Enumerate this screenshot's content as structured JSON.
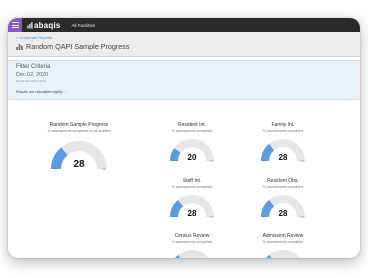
{
  "app": {
    "logo_text": "abaqis",
    "facility": "All Facilities"
  },
  "header": {
    "breadcrumb": "< Corporate Reports",
    "title": "Random QAPI Sample Progress"
  },
  "filter": {
    "title": "Filter Criteria",
    "date": "Dec 02, 2020",
    "date_label": "REFERENCE DATE",
    "note": "Results are calculated nightly ..."
  },
  "colors": {
    "accent_purple": "#8a57c8",
    "gauge_fill": "#5b9be0",
    "gauge_track": "#e6e6e6",
    "topbar": "#2b2b2d"
  },
  "gauges": [
    {
      "title": "Random Sample Progress",
      "subtitle": "% assessments completed for all facilities",
      "value": "28",
      "percent": 0.28,
      "min": "0",
      "max": "100"
    },
    {
      "title": "Resident Int.",
      "subtitle": "% assessments completed",
      "value": "20",
      "percent": 0.2,
      "min": "0",
      "max": "100"
    },
    {
      "title": "Family Int.",
      "subtitle": "% assessments completed",
      "value": "28",
      "percent": 0.28,
      "min": "0",
      "max": "100"
    },
    {
      "title": "Staff Int.",
      "subtitle": "% assessments completed",
      "value": "28",
      "percent": 0.28,
      "min": "0",
      "max": "100"
    },
    {
      "title": "Resident Obs.",
      "subtitle": "% assessments completed",
      "value": "28",
      "percent": 0.28,
      "min": "0",
      "max": "100"
    },
    {
      "title": "Census Review",
      "subtitle": "% assessments completed",
      "value": "",
      "percent": 0.28,
      "min": "",
      "max": ""
    },
    {
      "title": "Admission Review",
      "subtitle": "% assessments completed",
      "value": "",
      "percent": 0.28,
      "min": "",
      "max": ""
    }
  ]
}
